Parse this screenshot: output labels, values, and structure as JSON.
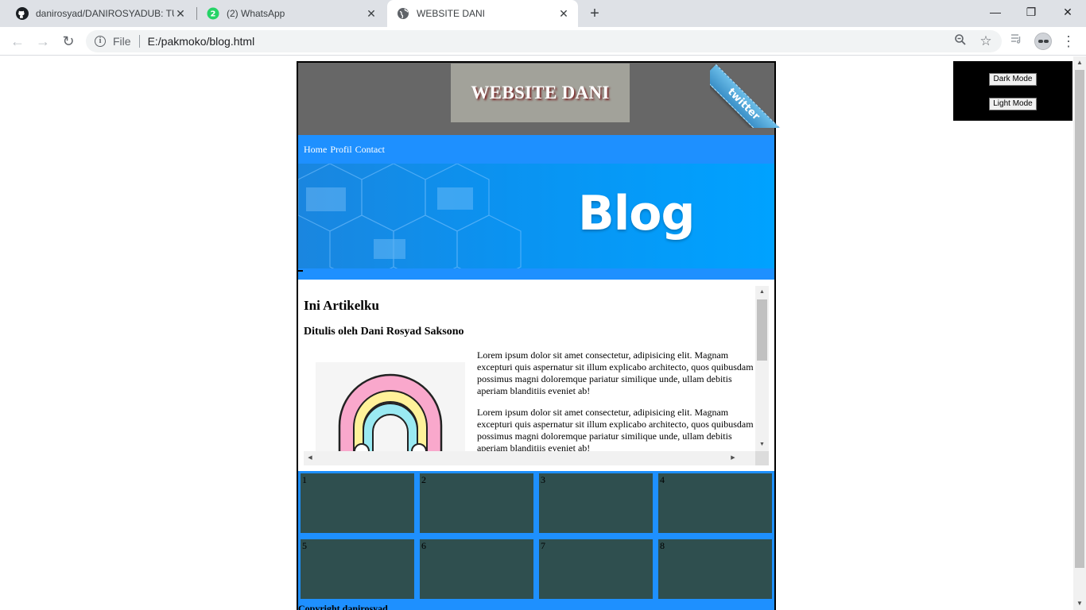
{
  "browser": {
    "tabs": [
      {
        "title": "danirosyad/DANIROSYADUB: TUG",
        "close": "✕",
        "favicon": "github-icon"
      },
      {
        "title": "(2) WhatsApp",
        "close": "✕",
        "favicon": "whatsapp-icon",
        "badge": "2"
      },
      {
        "title": "WEBSITE DANI",
        "close": "✕",
        "favicon": "globe-icon"
      }
    ],
    "new_tab": "+",
    "window_controls": {
      "minimize": "—",
      "restore": "❐",
      "close": "✕"
    },
    "nav": {
      "back": "←",
      "forward": "→",
      "reload": "↻"
    },
    "omnibox": {
      "scheme": "File",
      "url": "E:/pakmoko/blog.html"
    },
    "toolbar_icons": {
      "zoom": "zoom-icon",
      "bookmark": "☆",
      "media": "media-queue-icon",
      "profile": "avatar-icon",
      "menu": "⋮"
    }
  },
  "page": {
    "site_title": "WEBSITE DANI",
    "ribbon_text": "twitter",
    "nav_links": [
      "Home",
      "Profil",
      "Contact"
    ],
    "banner_text": "Blog",
    "article": {
      "heading": "Ini Artikelku",
      "byline": "Ditulis oleh Dani Rosyad Saksono",
      "paragraphs": [
        "Lorem ipsum dolor sit amet consectetur, adipisicing elit. Magnam excepturi quis aspernatur sit illum explicabo architecto, quos quibusdam possimus magni doloremque pariatur similique unde, ullam debitis aperiam blanditiis eveniet ab!",
        "Lorem ipsum dolor sit amet consectetur, adipisicing elit. Magnam excepturi quis aspernatur sit illum explicabo architecto, quos quibusdam possimus magni doloremque pariatur similique unde, ullam debitis aperiam blanditiis eveniet ab!"
      ]
    },
    "grid_cells": [
      "1",
      "2",
      "3",
      "4",
      "5",
      "6",
      "7",
      "8"
    ],
    "footer": "Copyright danirosyad",
    "mode_buttons": {
      "dark": "Dark Mode",
      "light": "Light Mode"
    }
  },
  "colors": {
    "header_bg": "#676767",
    "nav_bg": "#1e90ff",
    "grid_cell": "#2f4f4f",
    "title_box": "#a2a29a"
  }
}
